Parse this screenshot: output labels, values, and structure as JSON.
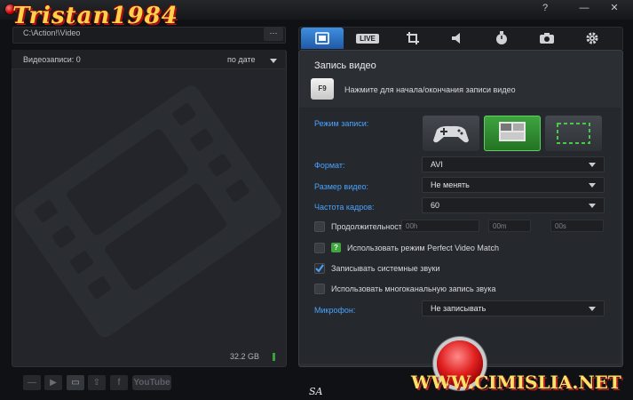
{
  "watermark": {
    "logo_text": "Tristan1984",
    "site_text": "WWW.CIMISLIA.NET",
    "corner_text": "SA"
  },
  "window": {
    "help_label": "?",
    "minimize_label": "—",
    "close_label": "✕"
  },
  "path": {
    "value": "C:\\Action!\\Video",
    "browse_label": "···"
  },
  "videos": {
    "count_label": "Видеозаписи: 0",
    "sort_label": "по дате",
    "storage": "32.2 GB"
  },
  "bottom_toolbar": {
    "youtube_label": "YouTube"
  },
  "tabs": [
    {
      "icon": "film-icon"
    },
    {
      "icon": "live-icon",
      "label": "LIVE"
    },
    {
      "icon": "crop-icon"
    },
    {
      "icon": "speaker-icon"
    },
    {
      "icon": "stopwatch-icon"
    },
    {
      "icon": "camera-icon"
    },
    {
      "icon": "gear-icon"
    }
  ],
  "record": {
    "title": "Запись видео",
    "hotkey": "F9",
    "hotkey_hint": "Нажмите для начала/окончания записи видео",
    "mode_label": "Режим записи:",
    "modes": [
      {
        "icon": "gamepad-icon"
      },
      {
        "icon": "desktop-icon",
        "selected": true
      },
      {
        "icon": "region-icon"
      }
    ],
    "format_label": "Формат:",
    "format_value": "AVI",
    "size_label": "Размер видео:",
    "size_value": "Не менять",
    "fps_label": "Частота кадров:",
    "fps_value": "60",
    "duration_label": "Продолжительность:",
    "duration_hours": "00h",
    "duration_minutes": "00m",
    "duration_seconds": "00s",
    "pvm_label": "Использовать режим Perfect Video Match",
    "pvm_help": "?",
    "system_sounds_label": "Записывать системные звуки",
    "system_sounds_checked": true,
    "multichannel_label": "Использовать многоканальную запись звука",
    "mic_label": "Микрофон:",
    "mic_value": "Не записывать"
  },
  "colors": {
    "accent": "#3f8fe0",
    "label_blue": "#4aa3ff",
    "record_red": "#e02020",
    "mode_selected": "#2f8a2f"
  }
}
